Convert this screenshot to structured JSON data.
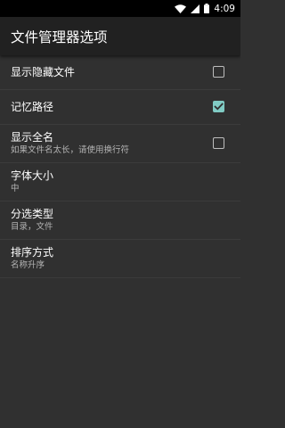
{
  "status_bar": {
    "time": "4:09",
    "icons": [
      "wifi-icon",
      "signal-icon",
      "battery-icon"
    ]
  },
  "app_bar": {
    "title": "文件管理器选项"
  },
  "preferences": [
    {
      "title": "显示隐藏文件",
      "summary": "",
      "checkbox": true,
      "checked": false
    },
    {
      "title": "记忆路径",
      "summary": "",
      "checkbox": true,
      "checked": true
    },
    {
      "title": "显示全名",
      "summary": "如果文件名太长，请使用换行符",
      "checkbox": true,
      "checked": false
    },
    {
      "title": "字体大小",
      "summary": "中",
      "checkbox": false
    },
    {
      "title": "分选类型",
      "summary": "目录，文件",
      "checkbox": false
    },
    {
      "title": "排序方式",
      "summary": "名称升序",
      "checkbox": false
    }
  ],
  "colors": {
    "background": "#303030",
    "app_bar": "#212121",
    "accent": "#80cbc4",
    "status_bar": "#000000"
  }
}
